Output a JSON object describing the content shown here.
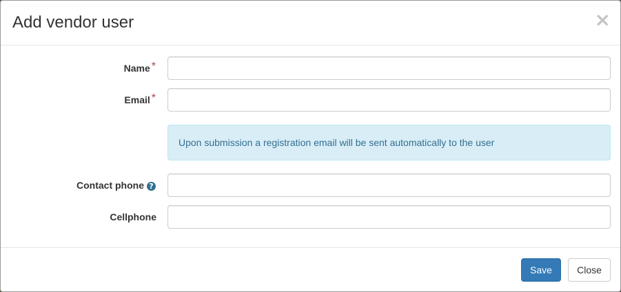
{
  "dialog": {
    "title": "Add vendor user",
    "close_glyph": "×"
  },
  "form": {
    "name": {
      "label": "Name",
      "required_mark": "*",
      "value": "",
      "placeholder": ""
    },
    "email": {
      "label": "Email",
      "required_mark": "*",
      "value": "",
      "placeholder": ""
    },
    "info_message": "Upon submission a registration email will be sent automatically to the user",
    "contact_phone": {
      "label": "Contact phone",
      "help_icon": "question-circle-icon",
      "help_glyph": "?",
      "value": "",
      "placeholder": ""
    },
    "cellphone": {
      "label": "Cellphone",
      "value": "",
      "placeholder": ""
    }
  },
  "footer": {
    "save_label": "Save",
    "close_label": "Close"
  },
  "colors": {
    "primary": "#337ab7",
    "info_bg": "#d9edf7",
    "info_text": "#31708f",
    "required": "#a94442"
  }
}
